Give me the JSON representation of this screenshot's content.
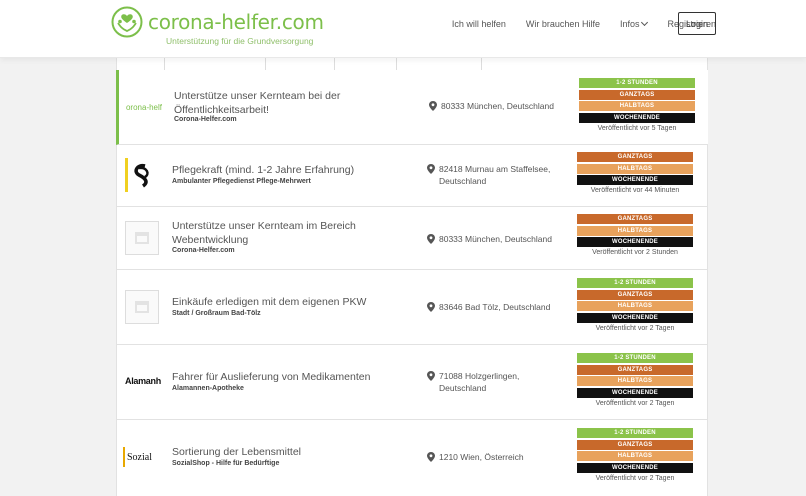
{
  "header": {
    "brand": "corona-helfer.com",
    "tagline": "Unterstützung für die Grundversorgung",
    "nav": [
      {
        "label": "Ich will helfen"
      },
      {
        "label": "Wir brauchen Hilfe"
      },
      {
        "label": "Infos"
      },
      {
        "label": "Registrieren"
      }
    ],
    "login_label": "Login"
  },
  "colors": {
    "brand_green": "#7cbf4a",
    "tag_stunden": "#8bc34a",
    "tag_ganztags": "#c8692b",
    "tag_halbtags": "#e8a25c",
    "tag_wochenende": "#111111"
  },
  "jobs": [
    {
      "title": "Unterstütze unser Kernteam bei der Öffentlichkeitsarbeit!",
      "company": "Corona-Helfer.com",
      "logo_text": "orona-helf",
      "location": "80333 München, Deutschland",
      "tags": [
        "1-2 STUNDEN",
        "GANZTAGS",
        "HALBTAGS",
        "WOCHENENDE"
      ],
      "posted": "Veröffentlicht vor 5 Tagen"
    },
    {
      "title": "Pflegekraft (mind. 1-2 Jahre Erfahrung)",
      "company": "Ambulanter Pflegedienst Pflege-Mehrwert",
      "location": "82418 Murnau am Staffelsee, Deutschland",
      "tags": [
        "GANZTAGS",
        "HALBTAGS",
        "WOCHENENDE"
      ],
      "posted": "Veröffentlicht vor 44 Minuten"
    },
    {
      "title": "Unterstütze unser Kernteam im Bereich Webentwicklung",
      "company": "Corona-Helfer.com",
      "location": "80333 München, Deutschland",
      "tags": [
        "GANZTAGS",
        "HALBTAGS",
        "WOCHENENDE"
      ],
      "posted": "Veröffentlicht vor 2 Stunden"
    },
    {
      "title": "Einkäufe erledigen mit dem eigenen PKW",
      "company": "Stadt / Großraum Bad-Tölz",
      "location": "83646 Bad Tölz, Deutschland",
      "tags": [
        "1-2 STUNDEN",
        "GANZTAGS",
        "HALBTAGS",
        "WOCHENENDE"
      ],
      "posted": "Veröffentlicht vor 2 Tagen"
    },
    {
      "title": "Fahrer für Auslieferung von Medikamenten",
      "company": "Alamannen-Apotheke",
      "logo_text": "Alamanheke",
      "location": "71088 Holzgerlingen, Deutschland",
      "tags": [
        "1-2 STUNDEN",
        "GANZTAGS",
        "HALBTAGS",
        "WOCHENENDE"
      ],
      "posted": "Veröffentlicht vor 2 Tagen"
    },
    {
      "title": "Sortierung der Lebensmittel",
      "company": "SozialShop - Hilfe für Bedürftige",
      "logo_text": "Sozial",
      "location": "1210 Wien, Österreich",
      "tags": [
        "1-2 STUNDEN",
        "GANZTAGS",
        "HALBTAGS",
        "WOCHENENDE"
      ],
      "posted": "Veröffentlicht vor 2 Tagen"
    }
  ]
}
